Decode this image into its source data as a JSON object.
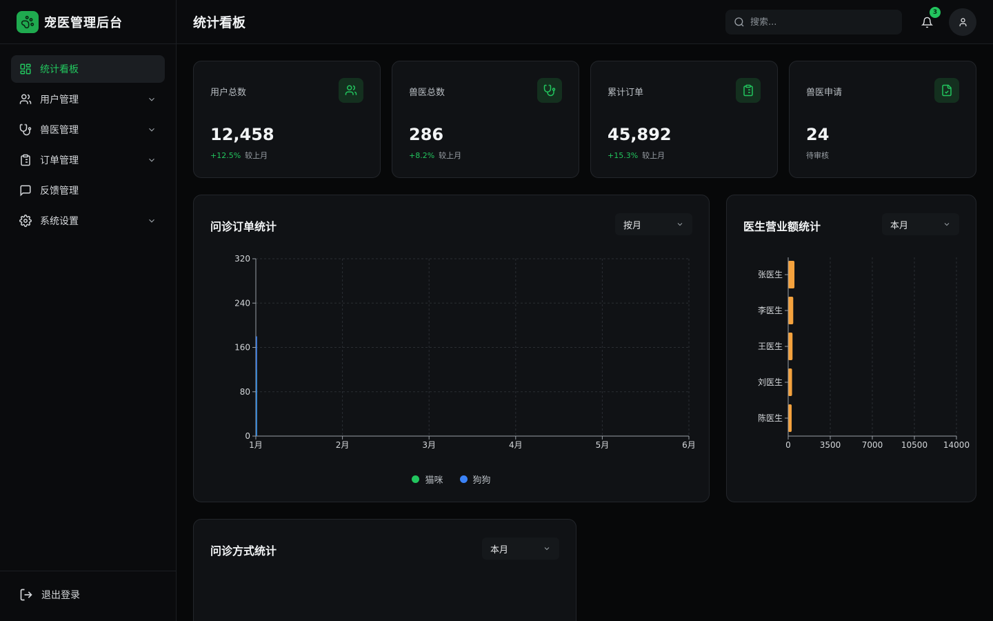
{
  "brand": {
    "title": "宠医管理后台"
  },
  "sidebar": {
    "items": [
      {
        "label": "统计看板",
        "icon": "dashboard-icon",
        "active": true,
        "expandable": false
      },
      {
        "label": "用户管理",
        "icon": "users-icon",
        "active": false,
        "expandable": true
      },
      {
        "label": "兽医管理",
        "icon": "stethoscope-icon",
        "active": false,
        "expandable": true
      },
      {
        "label": "订单管理",
        "icon": "clipboard-icon",
        "active": false,
        "expandable": true
      },
      {
        "label": "反馈管理",
        "icon": "message-icon",
        "active": false,
        "expandable": false
      },
      {
        "label": "系统设置",
        "icon": "gear-icon",
        "active": false,
        "expandable": true
      }
    ],
    "logout_label": "退出登录"
  },
  "header": {
    "title": "统计看板",
    "search_placeholder": "搜索...",
    "notification_count": "3"
  },
  "stats": [
    {
      "label": "用户总数",
      "value": "12,458",
      "change": "+12.5%",
      "suffix": "较上月",
      "icon": "users-icon"
    },
    {
      "label": "兽医总数",
      "value": "286",
      "change": "+8.2%",
      "suffix": "较上月",
      "icon": "stethoscope-icon"
    },
    {
      "label": "累计订单",
      "value": "45,892",
      "change": "+15.3%",
      "suffix": "较上月",
      "icon": "clipboard-icon"
    },
    {
      "label": "兽医申请",
      "value": "24",
      "change": "",
      "suffix": "待审核",
      "icon": "file-check-icon"
    }
  ],
  "order_panel": {
    "title": "问诊订单统计",
    "select_value": "按月"
  },
  "revenue_panel": {
    "title": "医生营业额统计",
    "select_value": "本月"
  },
  "method_panel": {
    "title": "问诊方式统计",
    "select_value": "本月"
  },
  "colors": {
    "accent": "#22c55e",
    "cat": "#22c55e",
    "dog": "#3b82f6",
    "bar": "#f5a23d"
  },
  "chart_data": [
    {
      "type": "line",
      "x": [
        "1月",
        "2月",
        "3月",
        "4月",
        "5月",
        "6月"
      ],
      "yticks": [
        0,
        80,
        160,
        240,
        320
      ],
      "ylim": [
        0,
        320
      ],
      "series": [
        {
          "name": "猫咪",
          "values": [
            120,
            null,
            null,
            null,
            null,
            null
          ]
        },
        {
          "name": "狗狗",
          "values": [
            180,
            null,
            null,
            null,
            null,
            null
          ]
        }
      ],
      "grid": true,
      "legend": "bottom"
    },
    {
      "type": "bar",
      "orientation": "horizontal",
      "categories": [
        "张医生",
        "李医生",
        "王医生",
        "刘医生",
        "陈医生"
      ],
      "values": [
        520,
        420,
        360,
        320,
        290
      ],
      "xticks": [
        0,
        3500,
        7000,
        10500,
        14000
      ],
      "xlim": [
        0,
        14000
      ],
      "grid": true
    }
  ]
}
